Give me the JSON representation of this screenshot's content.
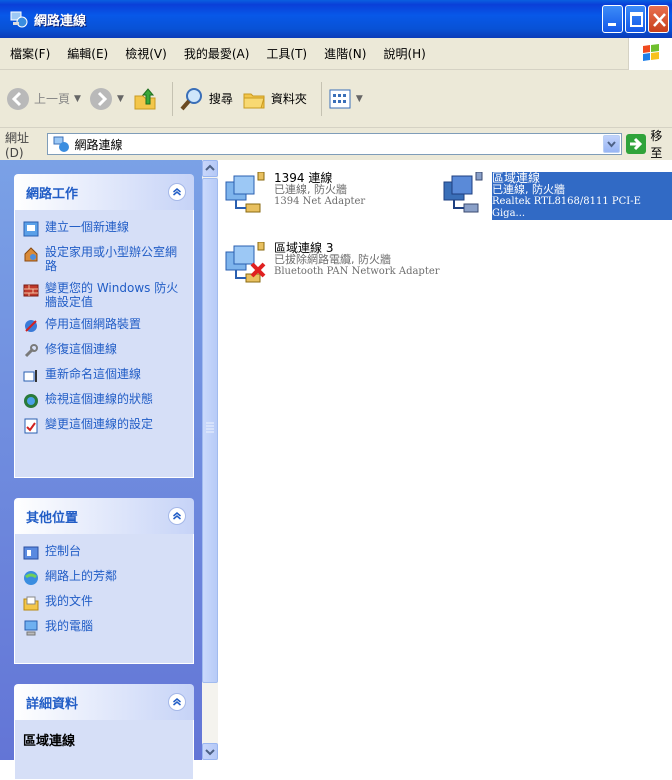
{
  "window": {
    "title": "網路連線"
  },
  "menu": [
    "檔案(F)",
    "編輯(E)",
    "檢視(V)",
    "我的最愛(A)",
    "工具(T)",
    "進階(N)",
    "說明(H)"
  ],
  "toolbar": {
    "back": "上一頁",
    "search": "搜尋",
    "folders": "資料夾"
  },
  "address": {
    "label": "網址(D)",
    "value": "網路連線",
    "go": "移至"
  },
  "tasks": {
    "network": {
      "title": "網路工作",
      "items": [
        {
          "label": "建立一個新連線",
          "icon": "new-connection-icon"
        },
        {
          "label": "設定家用或小型辦公室網路",
          "icon": "home-network-icon"
        },
        {
          "label": "變更您的 Windows 防火牆設定值",
          "icon": "firewall-icon"
        },
        {
          "label": "停用這個網路裝置",
          "icon": "disable-device-icon"
        },
        {
          "label": "修復這個連線",
          "icon": "repair-icon"
        },
        {
          "label": "重新命名這個連線",
          "icon": "rename-icon"
        },
        {
          "label": "檢視這個連線的狀態",
          "icon": "status-icon"
        },
        {
          "label": "變更這個連線的設定",
          "icon": "settings-icon"
        }
      ]
    },
    "other": {
      "title": "其他位置",
      "items": [
        {
          "label": "控制台",
          "icon": "control-panel-icon"
        },
        {
          "label": "網路上的芳鄰",
          "icon": "network-places-icon"
        },
        {
          "label": "我的文件",
          "icon": "my-documents-icon"
        },
        {
          "label": "我的電腦",
          "icon": "my-computer-icon"
        }
      ]
    },
    "details": {
      "title": "詳細資料",
      "name": "區域連線"
    }
  },
  "connections": [
    {
      "name": "1394 連線",
      "status": "已連線, 防火牆",
      "adapter": "1394 Net Adapter",
      "selected": false,
      "disconnected": false
    },
    {
      "name": "區域連線",
      "status": "已連線, 防火牆",
      "adapter": "Realtek RTL8168/8111 PCI-E Giga...",
      "selected": true,
      "disconnected": false
    },
    {
      "name": "區域連線 3",
      "status": "已拔除網路電纜, 防火牆",
      "adapter": "Bluetooth PAN Network Adapter",
      "selected": false,
      "disconnected": true
    }
  ],
  "colors": {
    "titlebar": "#0a52d8",
    "taskpane": "#6f8de0",
    "link": "#215dc6",
    "selection": "#316ac5"
  }
}
